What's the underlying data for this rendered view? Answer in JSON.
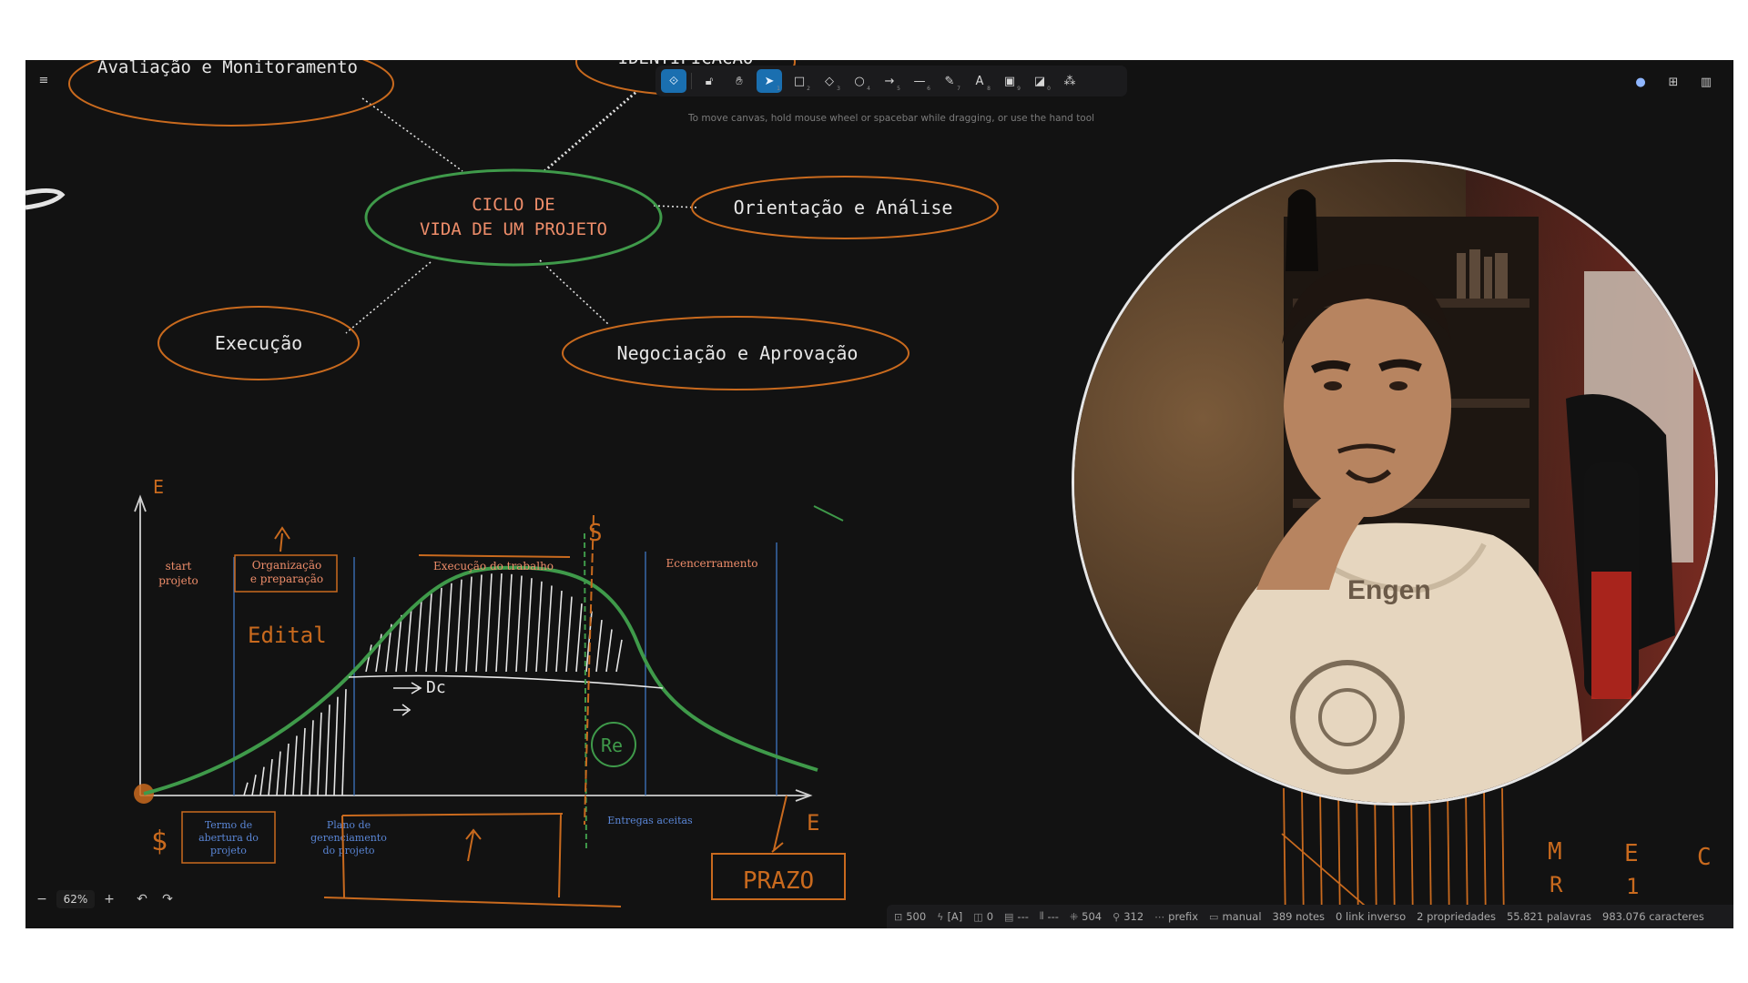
{
  "toolbar": {
    "tools": [
      {
        "name": "lock-icon",
        "glyph": "🔓︎",
        "key": ""
      },
      {
        "name": "hand-icon",
        "glyph": "✋︎",
        "key": ""
      },
      {
        "name": "selection-icon",
        "glyph": "➤",
        "key": "1"
      },
      {
        "name": "rectangle-icon",
        "glyph": "□",
        "key": "2"
      },
      {
        "name": "diamond-icon",
        "glyph": "◇",
        "key": "3"
      },
      {
        "name": "ellipse-icon",
        "glyph": "○",
        "key": "4"
      },
      {
        "name": "arrow-icon",
        "glyph": "→",
        "key": "5"
      },
      {
        "name": "line-icon",
        "glyph": "—",
        "key": "6"
      },
      {
        "name": "pencil-icon",
        "glyph": "✎",
        "key": "7"
      },
      {
        "name": "text-icon",
        "glyph": "A",
        "key": "8"
      },
      {
        "name": "image-icon",
        "glyph": "▣",
        "key": "9"
      },
      {
        "name": "eraser-icon",
        "glyph": "◪",
        "key": "0"
      },
      {
        "name": "shapes-library-icon",
        "glyph": "⁂",
        "key": ""
      }
    ],
    "active_tool": "selection-icon",
    "hint": "To move canvas, hold mouse wheel or spacebar while dragging, or use the hand tool"
  },
  "canvas": {
    "mindmap": {
      "center_line1": "CICLO DE",
      "center_line2": "VIDA DE UM PROJETO",
      "node_top_left": "Avaliação e Monitoramento",
      "node_top": "IDENTIFICACAO",
      "node_right": "Orientação e Análise",
      "node_left": "Execução",
      "node_bottom_right": "Negociação e Aprovação"
    },
    "graph": {
      "y_axis": "E",
      "x_axis": "E",
      "start_line1": "start",
      "start_line2": "projeto",
      "phase1_line1": "Organização",
      "phase1_line2": "e preparação",
      "phase2": "Execução do trabalho",
      "phase3": "Ecencerramento",
      "s_mark": "S",
      "edital": "Edital",
      "dc": "Dc",
      "re": "Re",
      "termo_line1": "Termo de",
      "termo_line2": "abertura do",
      "termo_line3": "projeto",
      "plano_line1": "Plano de",
      "plano_line2": "gerenciamento",
      "plano_line3": "do projeto",
      "entregas": "Entregas aceitas",
      "prazo": "PRAZO",
      "dollar": "$"
    },
    "corner_letters": [
      "M",
      "E",
      "C",
      "R",
      "1"
    ],
    "colors": {
      "orange": "#c96a1e",
      "green": "#3f9a4a",
      "blue": "#3a6fb5",
      "salmon": "#ee8d6a",
      "white": "#e4e4e4"
    }
  },
  "zoom": {
    "minus": "−",
    "level": "62%",
    "plus": "+",
    "undo": "↶",
    "redo": "↷"
  },
  "statusbar": {
    "items": [
      {
        "name": "robot-icon",
        "icon": "⊡",
        "text": "500"
      },
      {
        "name": "bolt-icon",
        "icon": "ϟ",
        "text": "[A]"
      },
      {
        "name": "tag-icon",
        "icon": "◫",
        "text": "0"
      },
      {
        "name": "list-icon",
        "icon": "▤",
        "text": "---"
      },
      {
        "name": "columns-icon",
        "icon": "⫴",
        "text": "---"
      },
      {
        "name": "graph-icon",
        "icon": "⁜",
        "text": "504"
      },
      {
        "name": "link-icon",
        "icon": "⚲",
        "text": "312"
      },
      {
        "name": "prefix-icon",
        "icon": "⋯",
        "text": "prefix"
      },
      {
        "name": "keyboard-icon",
        "icon": "▭",
        "text": "manual"
      },
      {
        "name": "notes-count",
        "icon": "",
        "text": "389 notes"
      },
      {
        "name": "backlink-count",
        "icon": "",
        "text": "0 link inverso"
      },
      {
        "name": "properties-count",
        "icon": "",
        "text": "2 propriedades"
      },
      {
        "name": "word-count",
        "icon": "",
        "text": "55.821 palavras"
      },
      {
        "name": "char-count",
        "icon": "",
        "text": "983.076 caracteres"
      }
    ]
  },
  "top_right_icons": [
    "droplet-icon",
    "new-note-icon",
    "reading-view-icon"
  ]
}
